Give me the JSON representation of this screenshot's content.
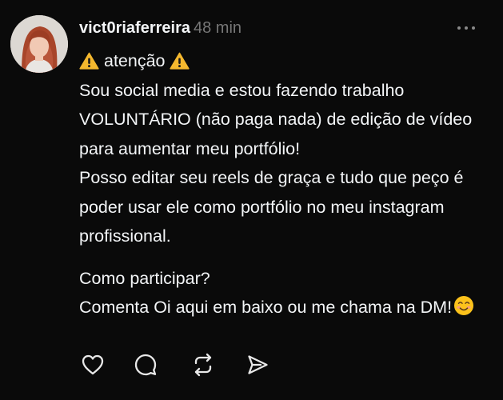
{
  "post": {
    "username": "vict0riaferreira",
    "time": "48 min",
    "line1": "atenção",
    "line2": "Sou social media e estou fazendo trabalho VOLUNTÁRIO (não paga nada) de edição de vídeo para aumentar meu portfólio!",
    "line3": "Posso editar seu reels de graça e tudo que peço é poder usar ele como portfólio no meu instagram profissional.",
    "line4": "Como participar?",
    "line5": "Comenta Oi aqui em baixo ou me chama na DM!"
  },
  "icons": {
    "avatar": "avatar",
    "more": "more-options-icon",
    "warning": "warning-icon",
    "smile": "smiling-face-icon",
    "like": "heart-icon",
    "reply": "comment-bubble-icon",
    "repost": "repost-icon",
    "share": "send-icon"
  },
  "colors": {
    "background": "#0a0a0a",
    "text": "#f3f5f7",
    "muted": "#777777",
    "warning": "#f5b82e"
  }
}
